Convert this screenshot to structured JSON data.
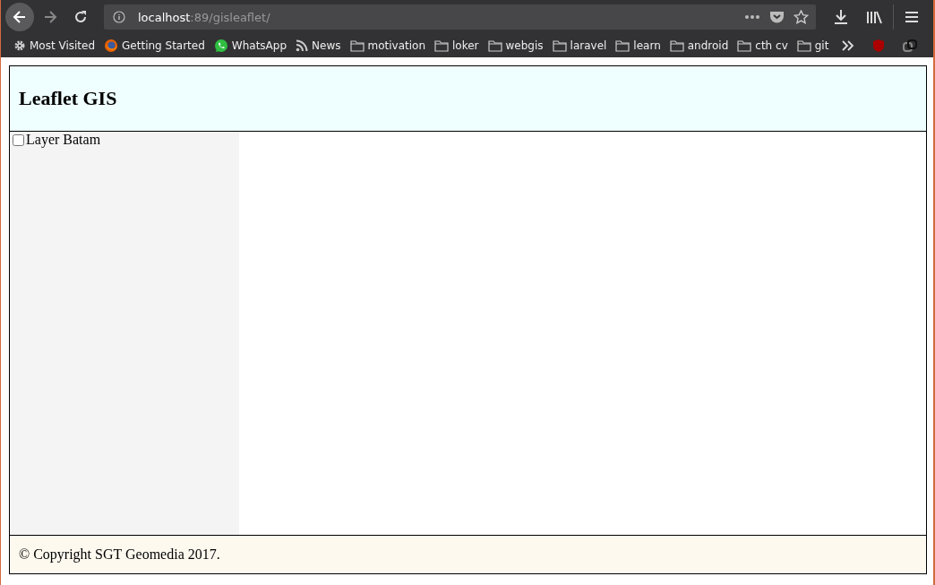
{
  "browser": {
    "url": {
      "host": "localhost",
      "path": ":89/gisleaflet/"
    },
    "bookmarks": [
      {
        "kind": "gear",
        "label": "Most Visited"
      },
      {
        "kind": "firefox",
        "label": "Getting Started"
      },
      {
        "kind": "whatsapp",
        "label": "WhatsApp"
      },
      {
        "kind": "rss",
        "label": "News"
      },
      {
        "kind": "folder",
        "label": "motivation"
      },
      {
        "kind": "folder",
        "label": "loker"
      },
      {
        "kind": "folder",
        "label": "webgis"
      },
      {
        "kind": "folder",
        "label": "laravel"
      },
      {
        "kind": "folder",
        "label": "learn"
      },
      {
        "kind": "folder",
        "label": "android"
      },
      {
        "kind": "folder",
        "label": "cth cv"
      },
      {
        "kind": "folder",
        "label": "git"
      }
    ]
  },
  "header": {
    "title": "Leaflet GIS"
  },
  "sidebar": {
    "layers": [
      {
        "label": "Layer Batam",
        "checked": false
      }
    ]
  },
  "footer": {
    "text": "© Copyright SGT Geomedia 2017."
  }
}
